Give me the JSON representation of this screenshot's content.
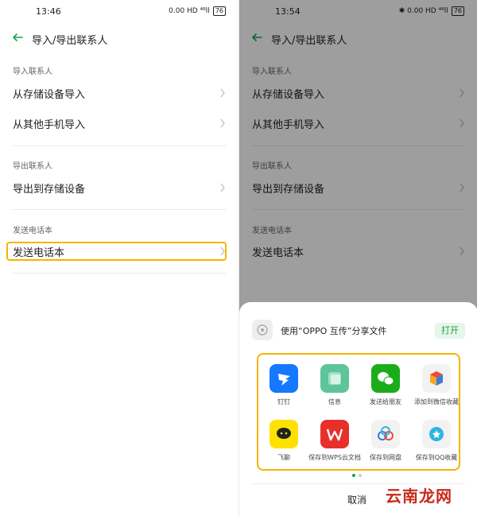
{
  "left": {
    "status": {
      "time": "13:46",
      "icons": "0.00 HD ⁴⁶ll",
      "battery": "76"
    },
    "title": "导入/导出联系人",
    "sections": [
      {
        "label": "导入联系人",
        "items": [
          "从存储设备导入",
          "从其他手机导入"
        ]
      },
      {
        "label": "导出联系人",
        "items": [
          "导出到存储设备"
        ]
      },
      {
        "label": "发送电话本",
        "items": [
          "发送电话本"
        ]
      }
    ]
  },
  "right": {
    "status": {
      "time": "13:54",
      "icons": "✱ 0.00 HD ⁴⁶ll",
      "battery": "76"
    },
    "title": "导入/导出联系人",
    "sections": [
      {
        "label": "导入联系人",
        "items": [
          "从存储设备导入",
          "从其他手机导入"
        ]
      },
      {
        "label": "导出联系人",
        "items": [
          "导出到存储设备"
        ]
      },
      {
        "label": "发送电话本",
        "items": [
          "发送电话本"
        ]
      }
    ],
    "sheet": {
      "share_text": "使用“OPPO 互传”分享文件",
      "open_label": "打开",
      "apps": [
        {
          "label": "钉钉",
          "icon": "dingtalk-icon",
          "color": "#1677ff"
        },
        {
          "label": "信息",
          "icon": "messages-icon",
          "color": "#5ec49a"
        },
        {
          "label": "发送给朋友",
          "icon": "wechat-icon",
          "color": "#1aad19"
        },
        {
          "label": "添加到微信收藏",
          "icon": "wechat-favorites-icon",
          "color": "#f2f2f2"
        },
        {
          "label": "飞聊",
          "icon": "feiliao-icon",
          "color": "#ffe100"
        },
        {
          "label": "保存到WPS云文档",
          "icon": "wps-icon",
          "color": "#e7302a"
        },
        {
          "label": "保存到网盘",
          "icon": "netdisk-icon",
          "color": "#f2f2f2"
        },
        {
          "label": "保存到QQ收藏",
          "icon": "qq-favorites-icon",
          "color": "#f2f2f2"
        }
      ],
      "cancel_label": "取消",
      "watermark": "云南龙网"
    }
  },
  "colors": {
    "accent": "#1aa14b",
    "highlight": "#f5b400"
  }
}
